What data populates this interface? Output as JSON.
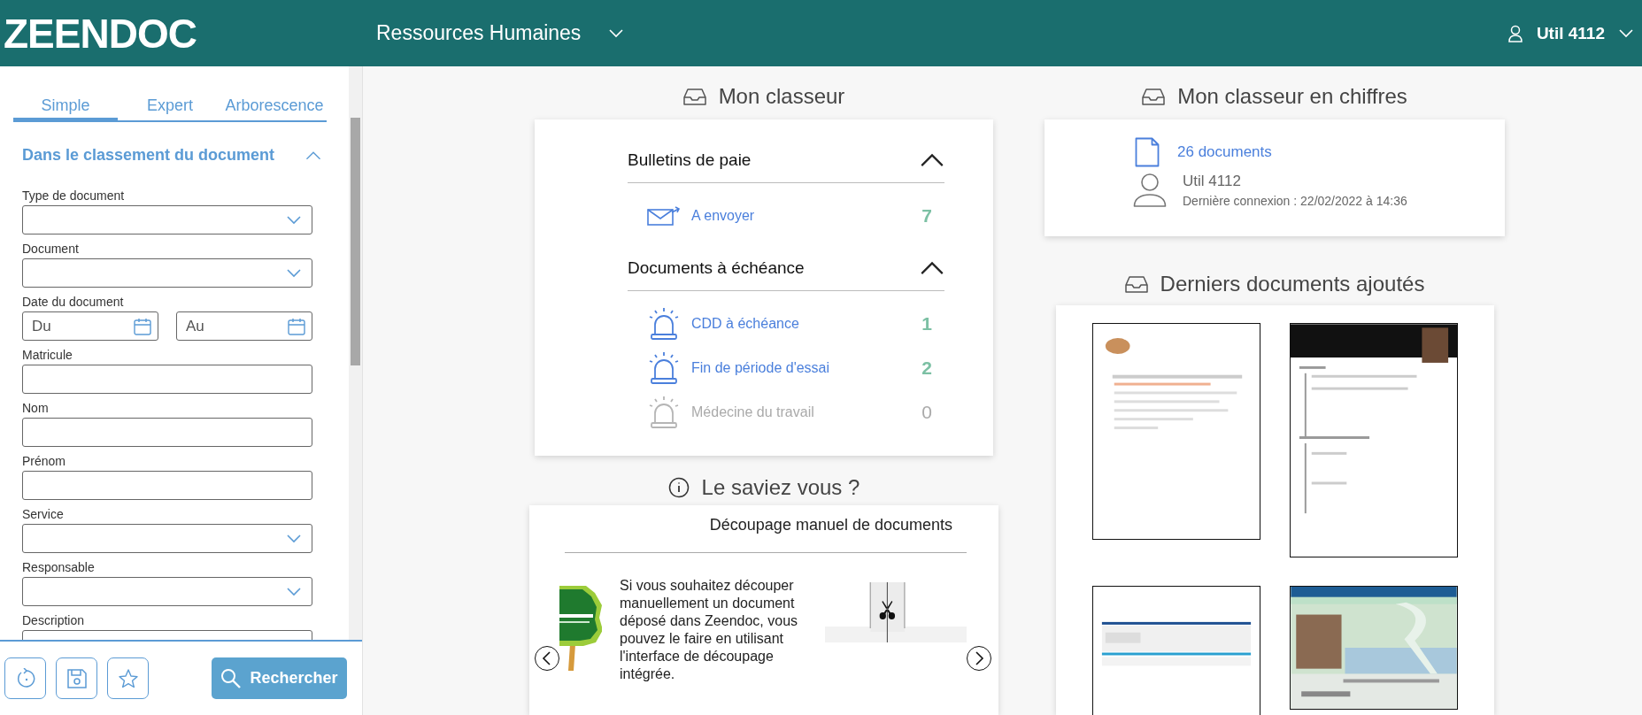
{
  "header": {
    "logo": "ZEENDOC",
    "module": "Ressources Humaines",
    "user": "Util 4112"
  },
  "sidebar": {
    "tabs": [
      {
        "label": "Simple",
        "selected": true
      },
      {
        "label": "Expert",
        "selected": false
      },
      {
        "label": "Arborescence",
        "selected": false
      }
    ],
    "section": {
      "title": "Dans le classement du document",
      "expanded": true
    },
    "fields": [
      {
        "kind": "select",
        "label": "Type de document"
      },
      {
        "kind": "select",
        "label": "Document"
      },
      {
        "kind": "daterange",
        "label": "Date du document",
        "from_placeholder": "Du",
        "to_placeholder": "Au"
      },
      {
        "kind": "text",
        "label": "Matricule"
      },
      {
        "kind": "text",
        "label": "Nom"
      },
      {
        "kind": "text",
        "label": "Prénom"
      },
      {
        "kind": "select",
        "label": "Service"
      },
      {
        "kind": "select",
        "label": "Responsable"
      },
      {
        "kind": "text",
        "label": "Description"
      }
    ],
    "search_button": "Rechercher"
  },
  "classeur": {
    "title": "Mon classeur",
    "groups": [
      {
        "title": "Bulletins de paie",
        "expanded": true,
        "items": [
          {
            "kind": "mail",
            "label": "A envoyer",
            "count": "7",
            "disabled": false
          }
        ]
      },
      {
        "title": "Documents à échéance",
        "expanded": true,
        "items": [
          {
            "kind": "alarm",
            "label": "CDD à échéance",
            "count": "1",
            "disabled": false
          },
          {
            "kind": "alarm",
            "label": "Fin de période d'essai",
            "count": "2",
            "disabled": false
          },
          {
            "kind": "alarm",
            "label": "Médecine du travail",
            "count": "0",
            "disabled": true
          }
        ]
      }
    ]
  },
  "tip": {
    "title": "Le saviez vous ?",
    "heading": "Découpage manuel de documents",
    "text": "Si vous souhaitez découper manuellement un document déposé dans Zeendoc, vous pouvez le faire en utilisant l'interface de découpage intégrée."
  },
  "stats": {
    "title": "Mon classeur en chiffres",
    "documents": "26 documents",
    "user": "Util 4112",
    "last_login": "Dernière connexion : 22/02/2022 à 14:36"
  },
  "recent": {
    "title": "Derniers documents ajoutés"
  }
}
